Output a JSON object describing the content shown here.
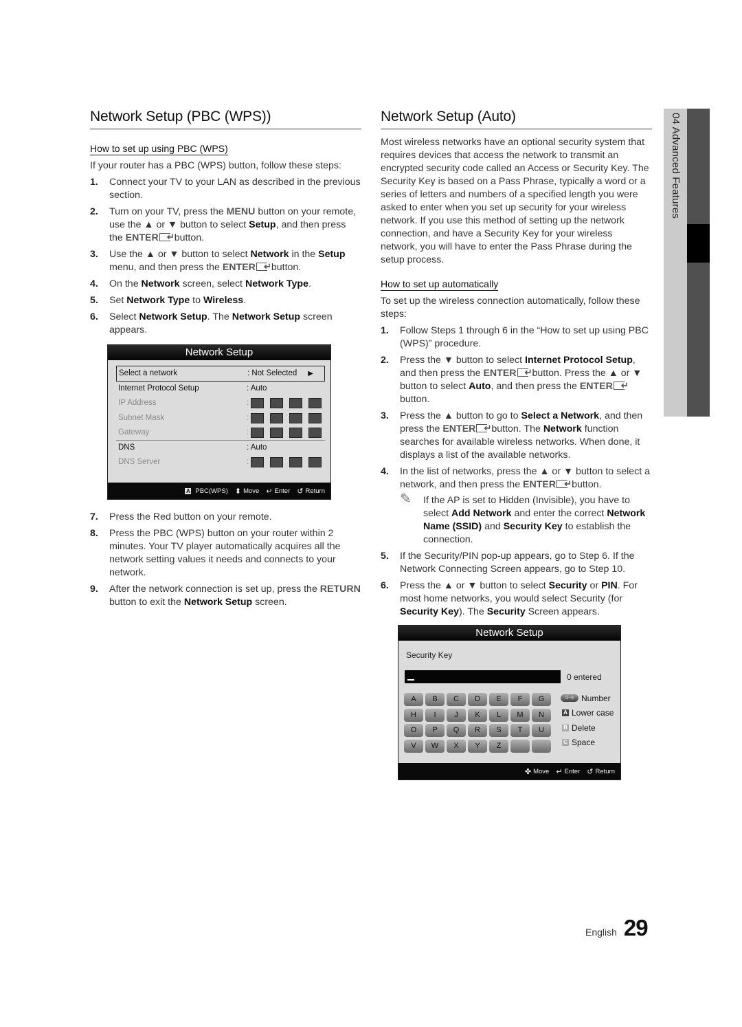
{
  "left": {
    "title": "Network Setup (PBC (WPS))",
    "subtitle": "How to set up using PBC (WPS)",
    "intro": "If your router has a PBC (WPS) button, follow these steps:",
    "steps": [
      {
        "num": "1.",
        "text": "Connect your TV to your LAN as described in the previous section."
      },
      {
        "num": "2.",
        "parts": [
          "Turn on your TV, press the ",
          "MENU",
          " button on your remote, use the ▲ or ▼ button to select ",
          "Setup",
          ", and then press the ",
          "ENTER",
          " button."
        ]
      },
      {
        "num": "3.",
        "parts": [
          "Use the ▲ or ▼ button to select ",
          "Network",
          " in the ",
          "Setup",
          " menu, and then press the ",
          "ENTER",
          " button."
        ]
      },
      {
        "num": "4.",
        "parts": [
          "On the ",
          "Network",
          " screen, select ",
          "Network Type",
          "."
        ]
      },
      {
        "num": "5.",
        "parts": [
          "Set ",
          "Network Type",
          " to ",
          "Wireless",
          "."
        ]
      },
      {
        "num": "6.",
        "parts": [
          "Select ",
          "Network Setup",
          ". The ",
          "Network Setup",
          " screen appears."
        ]
      },
      {
        "num": "7.",
        "text": "Press the Red button on your remote."
      },
      {
        "num": "8.",
        "text": "Press the PBC (WPS) button on your router within 2 minutes. Your TV player automatically acquires all the network setting values it needs and connects to your network."
      },
      {
        "num": "9.",
        "parts": [
          "After the network connection is set up, press the ",
          "RETURN",
          " button to exit the ",
          "Network Setup",
          " screen."
        ]
      }
    ],
    "screen": {
      "title": "Network Setup",
      "rows": [
        {
          "label": "Select a network",
          "value": ": Not Selected",
          "arrow": "▶"
        },
        {
          "label": "Internet Protocol Setup",
          "value": ": Auto"
        },
        {
          "label": "IP Address",
          "value": ":"
        },
        {
          "label": "Subnet Mask",
          "value": ":"
        },
        {
          "label": "Gateway",
          "value": ":"
        },
        {
          "label": "DNS",
          "value": ": Auto"
        },
        {
          "label": "DNS Server",
          "value": ":"
        }
      ],
      "footer": {
        "pbc_key": "A",
        "pbc_label": "PBC(WPS)",
        "move_label": "Move",
        "enter_label": "Enter",
        "return_label": "Return"
      }
    }
  },
  "right": {
    "title": "Network Setup (Auto)",
    "intro": "Most wireless networks have an optional security system that requires devices that access the network to transmit an encrypted security code called an Access or Security Key. The Security Key is based on a Pass Phrase, typically a word or a series of letters and numbers of a specified length you were asked to enter when you set up security for your wireless network.  If you use this method of setting up the network connection, and have a Security Key for your wireless network, you will have to enter the Pass Phrase during the setup process.",
    "subtitle": "How to set up automatically",
    "subintro": "To set up the wireless connection automatically, follow these steps:",
    "steps": [
      {
        "num": "1.",
        "text": "Follow Steps 1 through 6 in the “How to set up using PBC (WPS)” procedure."
      },
      {
        "num": "2.",
        "parts": [
          "Press the ▼ button to select ",
          "Internet Protocol Setup",
          ", and then press the ",
          "ENTER",
          " button. Press the ▲ or ▼ button to select ",
          "Auto",
          ", and then press the ",
          "ENTER",
          " button."
        ]
      },
      {
        "num": "3.",
        "parts": [
          "Press the ▲ button to go to ",
          "Select a Network",
          ", and then press the ",
          "ENTER",
          " button. The ",
          "Network",
          " function searches for available wireless networks. When done, it displays a list of the available networks."
        ]
      },
      {
        "num": "4.",
        "parts": [
          "In the list of networks, press the ▲ or ▼ button to select a network, and then press the ",
          "ENTER",
          " button."
        ]
      },
      {
        "num": "5.",
        "text": "If the Security/PIN pop-up appears, go to Step 6. If the Network Connecting Screen appears, go to Step 10."
      },
      {
        "num": "6.",
        "parts": [
          "Press the ▲ or ▼ button to select ",
          "Security",
          " or ",
          "PIN",
          ". For most home networks, you would select Security (for ",
          "Security Key",
          "). The ",
          "Security",
          " Screen appears."
        ]
      }
    ],
    "note": {
      "icon": "✎",
      "parts": [
        "If the AP is set to Hidden (Invisible), you have to select ",
        "Add Network",
        " and enter the correct ",
        "Network Name (SSID)",
        " and ",
        "Security Key",
        " to establish the connection."
      ]
    },
    "screen": {
      "title": "Network Setup",
      "field_label": "Security Key",
      "field_value": "",
      "count": "0 entered",
      "keys": [
        "A",
        "B",
        "C",
        "D",
        "E",
        "F",
        "G",
        "H",
        "I",
        "J",
        "K",
        "L",
        "M",
        "N",
        "O",
        "P",
        "Q",
        "R",
        "S",
        "T",
        "U",
        "V",
        "W",
        "X",
        "Y",
        "Z",
        "",
        ""
      ],
      "legend": [
        {
          "key": "0~9",
          "label": "Number"
        },
        {
          "key": "A",
          "label": "Lower case"
        },
        {
          "key": "B",
          "label": "Delete"
        },
        {
          "key": "C",
          "label": "Space"
        }
      ],
      "footer": {
        "move_label": "Move",
        "enter_label": "Enter",
        "return_label": "Return"
      }
    }
  },
  "side_tab": {
    "label": "04  Advanced Features"
  },
  "footer": {
    "language": "English",
    "page_number": "29"
  }
}
